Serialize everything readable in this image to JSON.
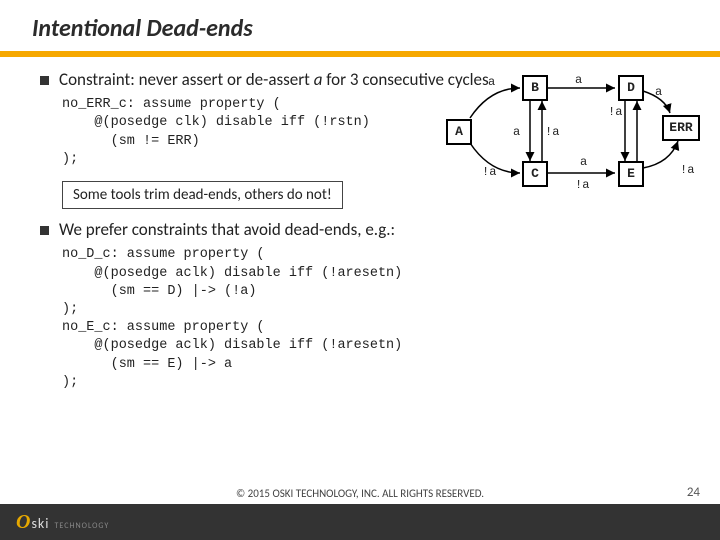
{
  "title": "Intentional Dead-ends",
  "bullet1_pre": "Constraint: never assert or de-assert ",
  "bullet1_var": "a",
  "bullet1_post": " for 3 consecutive cycles",
  "code1": "no_ERR_c: assume property (\n    @(posedge clk) disable iff (!rstn)\n      (sm != ERR)\n);",
  "note": "Some tools trim dead-ends, others do not!",
  "bullet2": "We prefer constraints that avoid dead-ends, e.g.:",
  "code2": "no_D_c: assume property (\n    @(posedge aclk) disable iff (!aresetn)\n      (sm == D) |-> (!a)\n);\nno_E_c: assume property (\n    @(posedge aclk) disable iff (!aresetn)\n      (sm == E) |-> a\n);",
  "copyright": "© 2015 OSKI TECHNOLOGY, INC.  ALL RIGHTS RESERVED.",
  "pagenum": "24",
  "logo": {
    "o": "O",
    "rest": "ski",
    "tech": "TECHNOLOGY"
  },
  "states": {
    "A": "A",
    "B": "B",
    "C": "C",
    "D": "D",
    "E": "E",
    "ERR": "ERR"
  },
  "edges": {
    "AB_a": "a",
    "AC_na": "!a",
    "BC_a": "a",
    "BC_na": "!a",
    "BD_a": "a",
    "CD_na": "!a",
    "CE_a": "a",
    "CE_na": "!a",
    "DERR_a": "a",
    "ENA_na": "!a"
  }
}
